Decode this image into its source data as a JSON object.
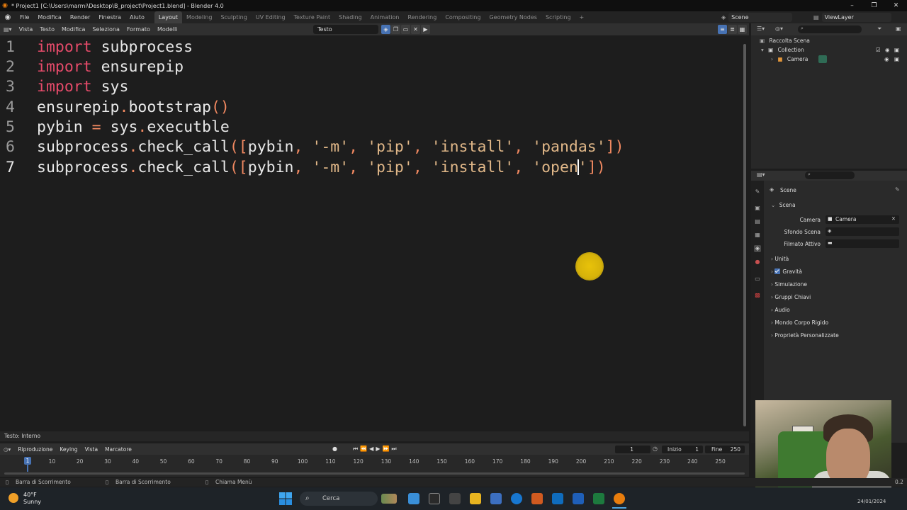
{
  "window": {
    "title": "* Project1 [C:\\Users\\marmi\\Desktop\\B_project\\Project1.blend] - Blender 4.0"
  },
  "menu": [
    "File",
    "Modifica",
    "Render",
    "Finestra",
    "Aiuto"
  ],
  "workspaces": [
    "Layout",
    "Modeling",
    "Sculpting",
    "UV Editing",
    "Texture Paint",
    "Shading",
    "Animation",
    "Rendering",
    "Compositing",
    "Geometry Nodes",
    "Scripting"
  ],
  "top_right": {
    "scene": "Scene",
    "view_layer": "ViewLayer"
  },
  "text_editor": {
    "menus": [
      "Vista",
      "Testo",
      "Modifica",
      "Seleziona",
      "Formato",
      "Modelli"
    ],
    "text_name": "Testo",
    "status": "Testo: Interno",
    "lines": [
      {
        "n": "1",
        "text": "import subprocess"
      },
      {
        "n": "2",
        "text": "import ensurepip"
      },
      {
        "n": "3",
        "text": "import sys"
      },
      {
        "n": "4",
        "text": "ensurepip.bootstrap()"
      },
      {
        "n": "5",
        "text": "pybin = sys.executble"
      },
      {
        "n": "6",
        "text": "subprocess.check_call([pybin, '-m', 'pip', 'install', 'pandas'])"
      },
      {
        "n": "7",
        "text": "subprocess.check_call([pybin, '-m', 'pip', 'install', 'open'])"
      }
    ],
    "current_line": "7"
  },
  "outliner": {
    "root": "Raccolta Scena",
    "collection": "Collection",
    "object": "Camera"
  },
  "properties": {
    "header": "Scene",
    "panel": "Scena",
    "fields": [
      {
        "label": "Camera",
        "value": "Camera"
      },
      {
        "label": "Sfondo Scena",
        "value": ""
      },
      {
        "label": "Filmato Attivo",
        "value": ""
      }
    ],
    "sections": [
      "Unità",
      "Gravità",
      "Simulazione",
      "Gruppi Chiavi",
      "Audio",
      "Mondo Corpo Rigido",
      "Proprietà Personalizzate"
    ]
  },
  "timeline": {
    "menus": [
      "Riproduzione",
      "Keying",
      "Vista",
      "Marcatore"
    ],
    "current_frame": "1",
    "start_label": "Inizio",
    "start": "1",
    "end_label": "Fine",
    "end": "250",
    "ticks": [
      "10",
      "20",
      "30",
      "40",
      "50",
      "60",
      "70",
      "80",
      "90",
      "100",
      "110",
      "120",
      "130",
      "140",
      "150",
      "160",
      "170",
      "180",
      "190",
      "200",
      "210",
      "220",
      "230",
      "240",
      "250"
    ]
  },
  "statusbar": [
    "Barra di Scorrimento",
    "Barra di Scorrimento",
    "Chiama Menù"
  ],
  "taskbar": {
    "temp": "40°F",
    "condition": "Sunny",
    "search": "Cerca",
    "date": "24/01/2024",
    "version": "0.2"
  }
}
